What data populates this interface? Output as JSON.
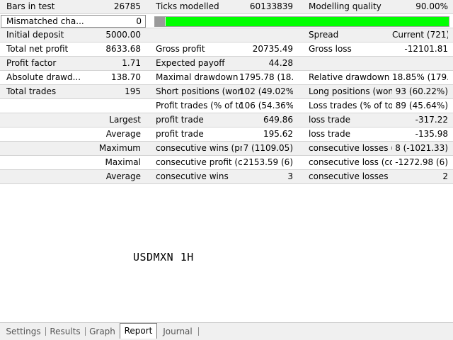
{
  "rows": [
    {
      "cells": [
        "Bars in test",
        "26785",
        "Ticks modelled",
        "60133839",
        "Modelling quality",
        "90.00%"
      ]
    },
    {
      "mismatch_label": "Mismatched cha...",
      "mismatch_value": "0",
      "modelling_quality_fraction": 0.9
    },
    {
      "cells": [
        "Initial deposit",
        "5000.00",
        "",
        "",
        "Spread",
        "Current (721)"
      ]
    },
    {
      "cells": [
        "Total net profit",
        "8633.68",
        "Gross profit",
        "20735.49",
        "Gross loss",
        "-12101.81"
      ]
    },
    {
      "cells": [
        "Profit factor",
        "1.71",
        "Expected payoff",
        "44.28",
        "",
        ""
      ]
    },
    {
      "cells": [
        "Absolute drawd...",
        "138.70",
        "Maximal drawdown",
        "1795.78 (18...",
        "Relative drawdown",
        "18.85% (179..."
      ]
    },
    {
      "cells": [
        "Total trades",
        "195",
        "Short positions (won...",
        "102 (49.02%)",
        "Long positions (won...",
        "93 (60.22%)"
      ]
    },
    {
      "cells": [
        "",
        "",
        "Profit trades (% of tot...",
        "106 (54.36%)",
        "Loss trades (% of total)",
        "89 (45.64%)"
      ]
    },
    {
      "label": "Largest",
      "cells": [
        "profit trade",
        "649.86",
        "loss trade",
        "-317.22"
      ]
    },
    {
      "label": "Average",
      "cells": [
        "profit trade",
        "195.62",
        "loss trade",
        "-135.98"
      ]
    },
    {
      "label": "Maximum",
      "cells": [
        "consecutive wins (pr...",
        "7 (1109.05)",
        "consecutive losses (l...",
        "8 (-1021.33)"
      ]
    },
    {
      "label": "Maximal",
      "cells": [
        "consecutive profit (c...",
        "2153.59 (6)",
        "consecutive loss (cou...",
        "-1272.98 (6)"
      ]
    },
    {
      "label": "Average",
      "cells": [
        "consecutive wins",
        "3",
        "consecutive losses",
        "2"
      ]
    }
  ],
  "symbol_label": "USDMXN 1H",
  "tabs": [
    {
      "label": "Settings",
      "active": false
    },
    {
      "label": "Results",
      "active": false
    },
    {
      "label": "Graph",
      "active": false
    },
    {
      "label": "Report",
      "active": true
    },
    {
      "label": "Journal",
      "active": false
    }
  ],
  "colors": {
    "progress_fill": "#00ff00",
    "row_gray": "#f0f0f0"
  }
}
